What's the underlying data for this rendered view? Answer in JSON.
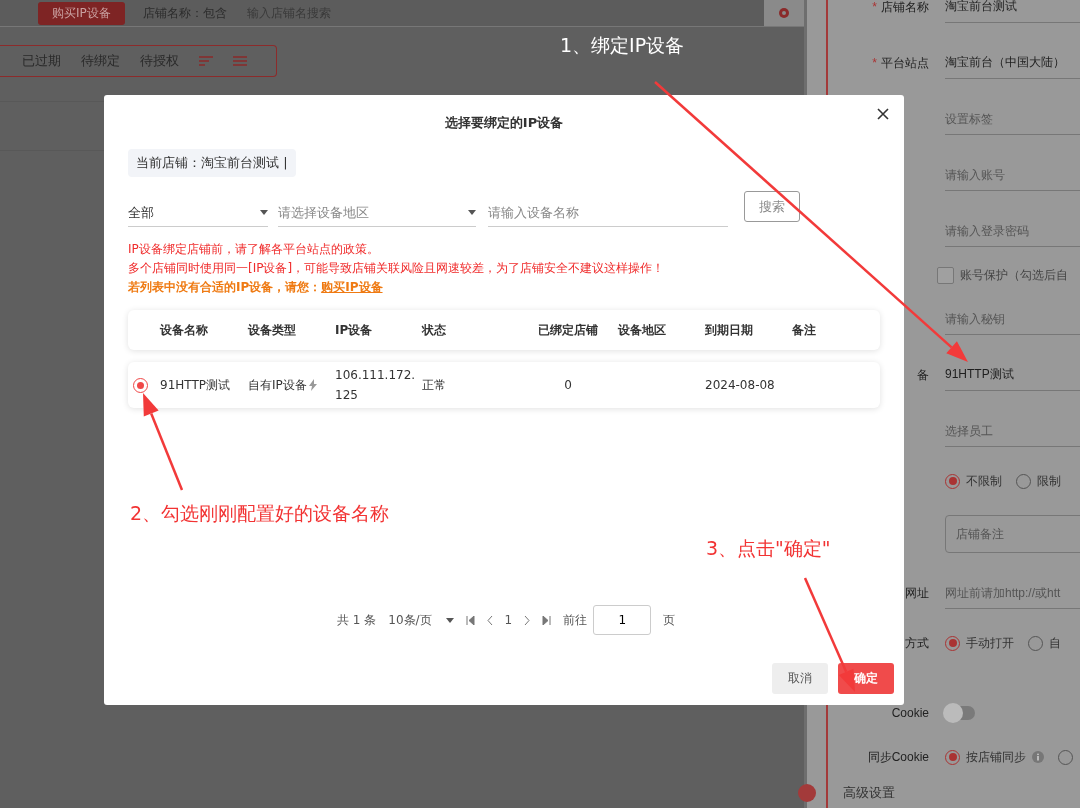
{
  "toolbar": {
    "buy_button": "购买IP设备",
    "shop_name_filter": "店铺名称：包含",
    "search": {
      "placeholder": "输入店铺名搜索"
    }
  },
  "status_filters": [
    {
      "label": "已过期"
    },
    {
      "label": "待绑定"
    },
    {
      "label": "待授权"
    }
  ],
  "shop_form": {
    "rows": [
      {
        "kind": "text",
        "label": "店铺名称",
        "required_mark": "*",
        "value": "淘宝前台测试"
      },
      {
        "kind": "text",
        "label": "平台站点",
        "required_mark": "*",
        "value": "淘宝前台（中国大陆）"
      },
      {
        "kind": "text",
        "placeholder": "设置标签"
      },
      {
        "kind": "text",
        "placeholder": "请输入账号"
      },
      {
        "kind": "text",
        "placeholder": "请输入登录密码"
      },
      {
        "kind": "checkbox",
        "checked": false,
        "text": "账号保护（勾选后自"
      },
      {
        "kind": "text",
        "placeholder": "请输入秘钥"
      },
      {
        "kind": "text",
        "label": "备",
        "value": "91HTTP测试"
      },
      {
        "kind": "text",
        "placeholder": "选择员工"
      },
      {
        "kind": "radio",
        "options": [
          {
            "label": "不限制",
            "selected": true
          },
          {
            "label": "限制",
            "selected": false
          }
        ]
      },
      {
        "kind": "textarea",
        "placeholder": "店铺备注"
      },
      {
        "kind": "text",
        "label": "网址",
        "placeholder": "网址前请加http://或htt"
      },
      {
        "kind": "radio",
        "label": "方式",
        "options": [
          {
            "label": "手动打开",
            "selected": true
          },
          {
            "label": "自",
            "selected": false
          }
        ]
      },
      {
        "kind": "toggle",
        "label": "Cookie",
        "on": false
      },
      {
        "kind": "radio",
        "label": "同步Cookie",
        "options": [
          {
            "label": "按店铺同步",
            "selected": true,
            "info": true
          },
          {
            "selected": false
          }
        ]
      },
      {
        "kind": "section",
        "label": "高级设置"
      }
    ]
  },
  "dialog": {
    "title": "选择要绑定的IP设备",
    "current_shop": "当前店铺：淘宝前台测试 |",
    "type_select": {
      "value": "全部"
    },
    "region_select": {
      "placeholder": "请选择设备地区"
    },
    "name_search": {
      "placeholder": "请输入设备名称"
    },
    "search_button": "搜索",
    "notices": [
      {
        "kind": "warning",
        "text": "IP设备绑定店铺前，请了解各平台站点的政策。"
      },
      {
        "kind": "warning",
        "text": "多个店铺同时使用同一[IP设备]，可能导致店铺关联风险且网速较差，为了店铺安全不建议这样操作！"
      },
      {
        "kind": "hint",
        "text": "若列表中没有合适的IP设备，请您：",
        "link": "购买IP设备"
      }
    ],
    "table": {
      "columns": [
        "设备名称",
        "设备类型",
        "IP设备",
        "状态",
        "已绑定店铺",
        "设备地区",
        "到期日期",
        "备注"
      ],
      "rows": [
        {
          "selected": true,
          "name": "91HTTP测试",
          "type": "自有IP设备",
          "ip": "106.111.172.125",
          "status": "正常",
          "bound_shops": "0",
          "expiry": "2024-08-08"
        }
      ]
    },
    "pagination": {
      "total": "共 1 条",
      "page_size": "10条/页",
      "current_page": "1",
      "goto_label": "前往",
      "goto_value": "1",
      "page_suffix": "页"
    },
    "buttons": {
      "cancel": "取消",
      "confirm": "确定"
    }
  },
  "annotations": [
    {
      "kind": "light",
      "text": "1、绑定IP设备"
    },
    {
      "kind": "red",
      "text": "2、勾选刚刚配置好的设备名称"
    },
    {
      "kind": "red",
      "text": "3、点击\"确定\""
    }
  ]
}
